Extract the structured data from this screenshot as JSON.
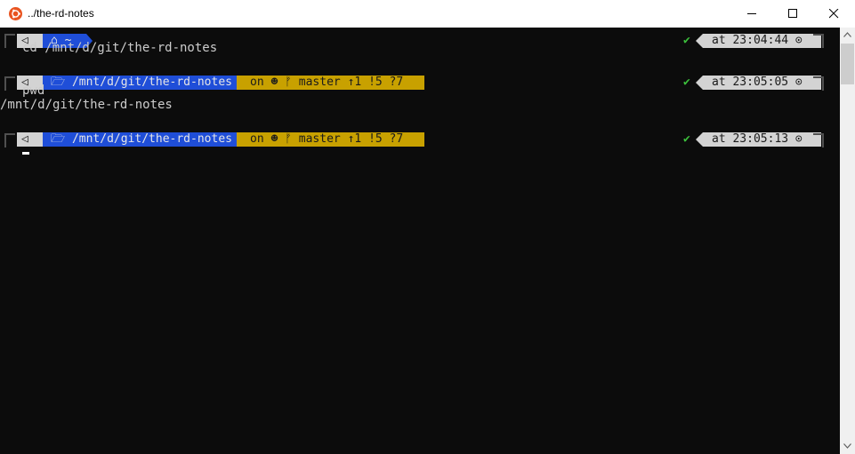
{
  "window": {
    "title": "../the-rd-notes",
    "app": "Ubuntu"
  },
  "prompts": [
    {
      "os_icon": "◁",
      "path_icon": "home-icon",
      "path": "~",
      "git": null,
      "status": "✔",
      "time": "at 23:04:44"
    },
    {
      "os_icon": "◁",
      "path_icon": "folder-icon",
      "path": "/mnt/d/git/the-rd-notes",
      "git": {
        "on": "on",
        "branch": "master",
        "ahead": "↑1",
        "modified": "!5",
        "untracked": "?7"
      },
      "status": "✔",
      "time": "at 23:05:05"
    },
    {
      "os_icon": "◁",
      "path_icon": "folder-icon",
      "path": "/mnt/d/git/the-rd-notes",
      "git": {
        "on": "on",
        "branch": "master",
        "ahead": "↑1",
        "modified": "!5",
        "untracked": "?7"
      },
      "status": "✔",
      "time": "at 23:05:13"
    }
  ],
  "commands": [
    "cd /mnt/d/git/the-rd-notes",
    "pwd"
  ],
  "outputs": [
    "/mnt/d/git/the-rd-notes"
  ],
  "colors": {
    "background": "#0c0c0c",
    "path_segment": "#1f4ed8",
    "git_segment": "#c8a100",
    "os_segment": "#d3d3d3",
    "ok": "#3cbf3c"
  }
}
